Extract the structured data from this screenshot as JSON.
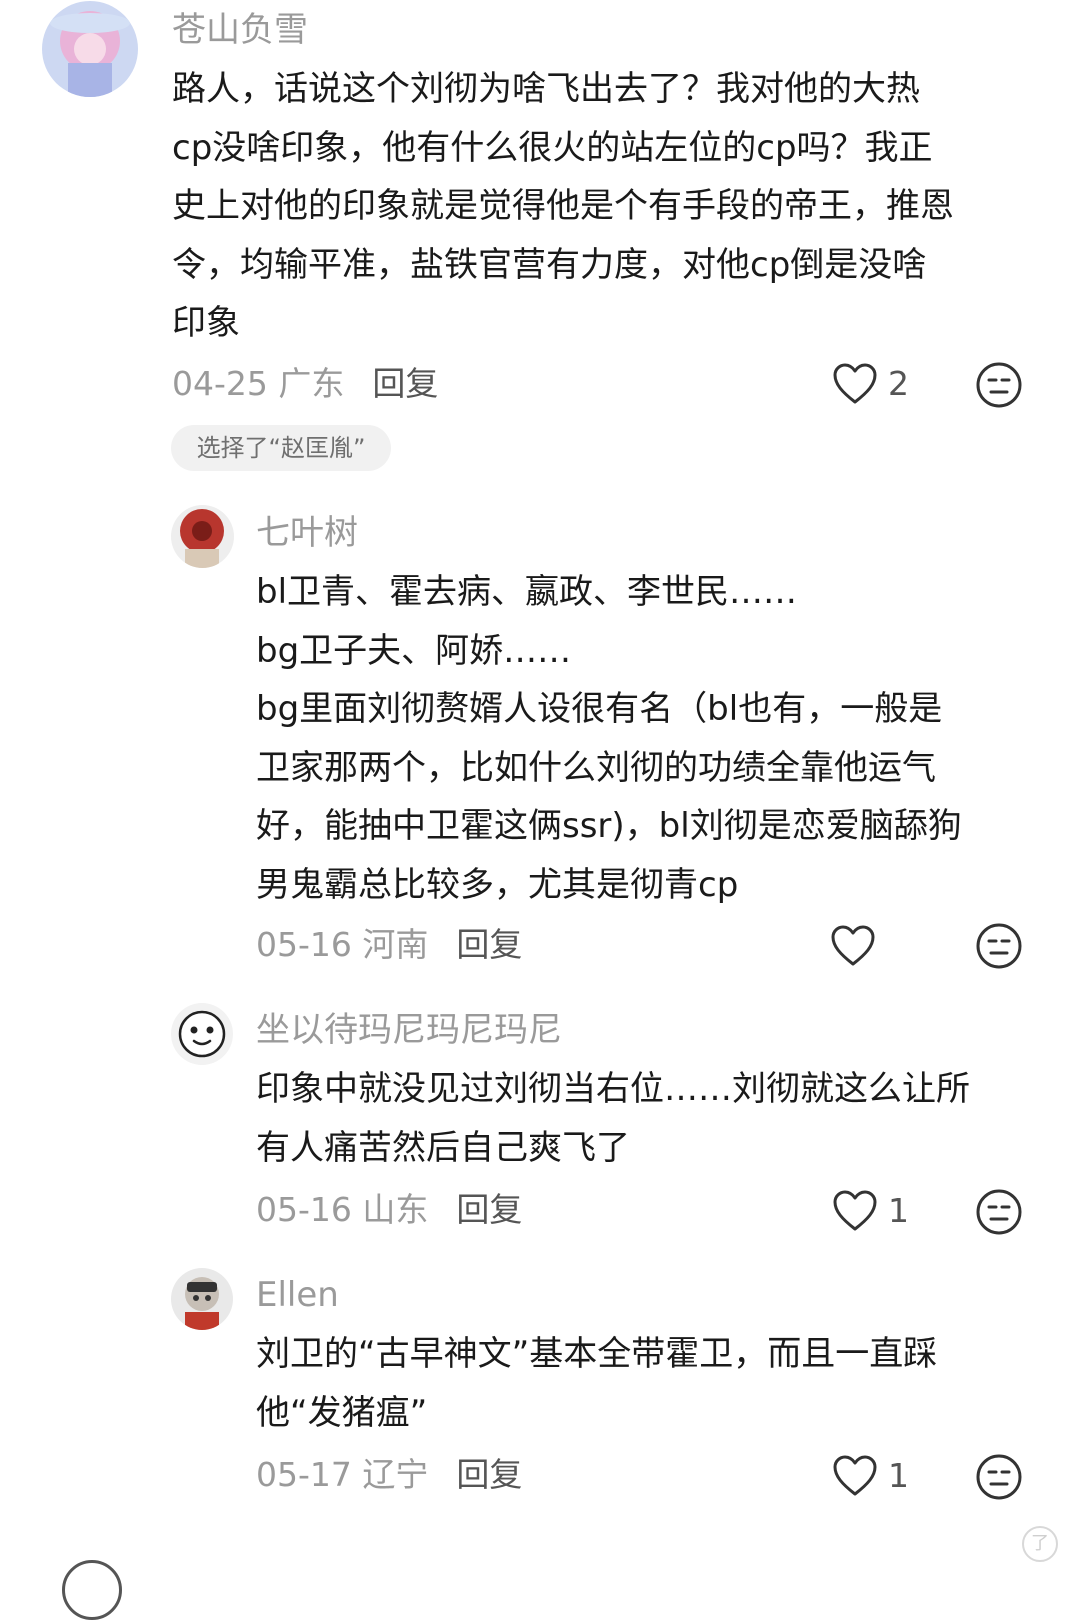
{
  "comments": [
    {
      "username": "苍山负雪",
      "lines": [
        "路人，话说这个刘彻为啥飞出去了？我对他的大热",
        "cp没啥印象，他有什么很火的站左位的cp吗？我正",
        "史上对他的印象就是觉得他是个有手段的帝王，推恩",
        "令，均输平准，盐铁官营有力度，对他cp倒是没啥",
        "印象"
      ],
      "date": "04-25 广东",
      "reply": "回复",
      "likes": "2",
      "icons": {
        "like": "heart-outline-icon",
        "dislike": "neutral-face-icon"
      }
    },
    {
      "username": "七叶树",
      "lines": [
        "bl卫青、霍去病、嬴政、李世民……",
        "bg卫子夫、阿娇……",
        "bg里面刘彻赘婿人设很有名（bl也有，一般是",
        "卫家那两个，比如什么刘彻的功绩全靠他运气",
        "好，能抽中卫霍这俩ssr)，bl刘彻是恋爱脑舔狗",
        "男鬼霸总比较多，尤其是彻青cp"
      ],
      "date": "05-16 河南",
      "reply": "回复",
      "likes": "",
      "icons": {
        "like": "heart-outline-icon",
        "dislike": "neutral-face-icon"
      }
    },
    {
      "username": "坐以待玛尼玛尼玛尼",
      "lines": [
        "印象中就没见过刘彻当右位……刘彻就这么让所",
        "有人痛苦然后自己爽飞了"
      ],
      "date": "05-16 山东",
      "reply": "回复",
      "likes": "1",
      "icons": {
        "like": "heart-outline-icon",
        "dislike": "neutral-face-icon"
      }
    },
    {
      "username": "Ellen",
      "lines": [
        "刘卫的“古早神文”基本全带霍卫，而且一直踩",
        "他“发猪瘟”"
      ],
      "date": "05-17 辽宁",
      "reply": "回复",
      "likes": "1",
      "icons": {
        "like": "heart-outline-icon",
        "dislike": "neutral-face-icon"
      }
    }
  ],
  "vote_chip": "选择了“赵匡胤”",
  "watermark": "了",
  "colors": {
    "text": "#1a1a1a",
    "muted": "#9a9a9a",
    "reply": "#555555",
    "chip_bg": "#f1f1f1",
    "icon": "#333333"
  }
}
